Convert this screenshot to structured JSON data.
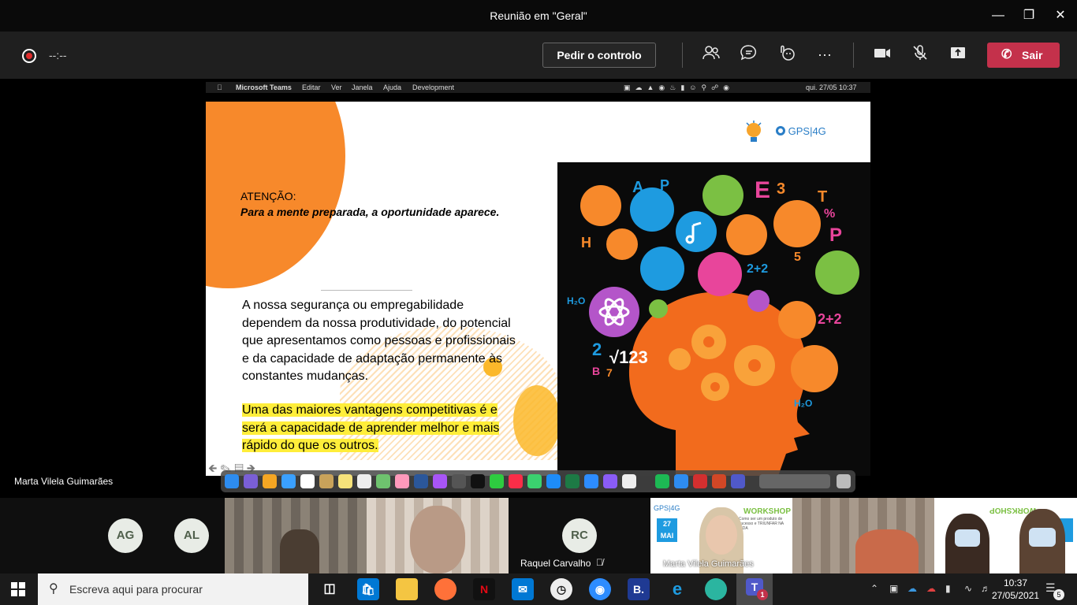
{
  "window": {
    "title": "Reunião em \"Geral\""
  },
  "toolbar": {
    "timer": "--:--",
    "request_control_label": "Pedir o controlo",
    "leave_label": "Sair"
  },
  "mac_menu": {
    "items": [
      "Microsoft Teams",
      "Editar",
      "Ver",
      "Janela",
      "Ajuda",
      "Development"
    ],
    "datetime": "qui. 27/05  10:37"
  },
  "slide": {
    "logo_text": "GPS|4G",
    "attention": "ATENÇÃO:",
    "quote": "Para a mente preparada, a oportunidade aparece.",
    "paragraph": "A nossa segurança ou empregabilidade dependem da nossa produtividade, do potencial que apresentamos como pessoas e profissionais e da capacidade de adaptação permanente às constantes mudanças.",
    "highlight": "Uma das maiores vantagens competitivas é e será a capacidade de aprender melhor e mais rápido do que os outros."
  },
  "stage": {
    "speaker_name": "Marta Vilela Guimarães"
  },
  "participants": {
    "avatars": [
      {
        "initials": "AG"
      },
      {
        "initials": "AL"
      },
      {
        "initials": "RC"
      }
    ],
    "rc_name": "Raquel Carvalho",
    "video_name": "Marta Vilela Guimarães",
    "workshop_title": "WORKSHOP",
    "workshop_sub": "Como ser um produto de sucesso e TRIUNFAR NA VIDA",
    "workshop_date": "27 MAI"
  },
  "taskbar": {
    "search_placeholder": "Escreva aqui para procurar",
    "time": "10:37",
    "date": "27/05/2021",
    "notifications": "5",
    "teams_badge": "1"
  }
}
